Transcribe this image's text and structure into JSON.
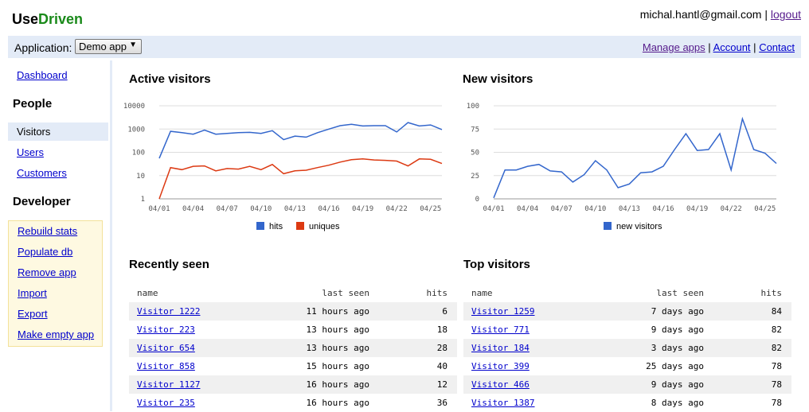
{
  "brand": {
    "part1": "Use",
    "part2": "Driven"
  },
  "user": {
    "email": "michal.hantl@gmail.com",
    "separator": "|",
    "logout": "logout"
  },
  "appbar": {
    "label": "Application:",
    "selected_app": "Demo app",
    "links": [
      "Manage apps",
      "Account",
      "Contact"
    ],
    "separator": "|"
  },
  "sidebar": {
    "dashboard": "Dashboard",
    "people_heading": "People",
    "people_items": [
      "Visitors",
      "Users",
      "Customers"
    ],
    "developer_heading": "Developer",
    "developer_items": [
      "Rebuild stats",
      "Populate db",
      "Remove app",
      "Import",
      "Export",
      "Make empty app"
    ]
  },
  "colors": {
    "accent_bg": "#e3ebf7",
    "series_blue": "#3366cc",
    "series_red": "#dc3912",
    "brand_green": "#1a8a1a"
  },
  "dates": [
    "04/01",
    "04/02",
    "04/03",
    "04/04",
    "04/05",
    "04/06",
    "04/07",
    "04/08",
    "04/09",
    "04/10",
    "04/11",
    "04/12",
    "04/13",
    "04/14",
    "04/15",
    "04/16",
    "04/17",
    "04/18",
    "04/19",
    "04/20",
    "04/21",
    "04/22",
    "04/23",
    "04/24",
    "04/25",
    "04/26"
  ],
  "chart_data": [
    {
      "type": "line",
      "title": "Active visitors",
      "y_scale": "log",
      "ylim": [
        1,
        10000
      ],
      "y_ticks": [
        "10000",
        "1000",
        "100",
        "10",
        "1"
      ],
      "x_ticks": [
        "04/01",
        "04/04",
        "04/07",
        "04/10",
        "04/13",
        "04/16",
        "04/19",
        "04/22",
        "04/25"
      ],
      "legend_position": "bottom",
      "series": [
        {
          "name": "hits",
          "color": "#3366cc",
          "values": [
            55,
            800,
            700,
            600,
            900,
            600,
            650,
            700,
            720,
            650,
            850,
            350,
            500,
            450,
            700,
            1000,
            1400,
            1600,
            1350,
            1400,
            1400,
            750,
            1900,
            1350,
            1500,
            950
          ]
        },
        {
          "name": "uniques",
          "color": "#dc3912",
          "values": [
            1,
            22,
            18,
            25,
            26,
            16,
            20,
            19,
            25,
            18,
            30,
            12,
            16,
            17,
            22,
            28,
            38,
            48,
            52,
            47,
            45,
            42,
            26,
            52,
            50,
            33
          ]
        }
      ]
    },
    {
      "type": "line",
      "title": "New visitors",
      "ylim": [
        0,
        100
      ],
      "y_ticks": [
        "100",
        "75",
        "50",
        "25",
        "0"
      ],
      "x_ticks": [
        "04/01",
        "04/04",
        "04/07",
        "04/10",
        "04/13",
        "04/16",
        "04/19",
        "04/22",
        "04/25"
      ],
      "legend_position": "bottom",
      "series": [
        {
          "name": "new visitors",
          "color": "#3366cc",
          "values": [
            1,
            31,
            31,
            35,
            37,
            30,
            29,
            18,
            26,
            41,
            31,
            12,
            16,
            28,
            29,
            35,
            53,
            70,
            52,
            53,
            70,
            31,
            86,
            53,
            49,
            38
          ]
        }
      ]
    }
  ],
  "recent": {
    "title": "Recently seen",
    "headers": [
      "name",
      "last seen",
      "hits"
    ],
    "rows": [
      [
        "Visitor 1222",
        "11 hours ago",
        "6"
      ],
      [
        "Visitor 223",
        "13 hours ago",
        "18"
      ],
      [
        "Visitor 654",
        "13 hours ago",
        "28"
      ],
      [
        "Visitor 858",
        "15 hours ago",
        "40"
      ],
      [
        "Visitor 1127",
        "16 hours ago",
        "12"
      ],
      [
        "Visitor 235",
        "16 hours ago",
        "36"
      ]
    ]
  },
  "top": {
    "title": "Top visitors",
    "headers": [
      "name",
      "last seen",
      "hits"
    ],
    "rows": [
      [
        "Visitor 1259",
        "7 days ago",
        "84"
      ],
      [
        "Visitor 771",
        "9 days ago",
        "82"
      ],
      [
        "Visitor 184",
        "3 days ago",
        "82"
      ],
      [
        "Visitor 399",
        "25 days ago",
        "78"
      ],
      [
        "Visitor 466",
        "9 days ago",
        "78"
      ],
      [
        "Visitor 1387",
        "8 days ago",
        "78"
      ]
    ]
  }
}
